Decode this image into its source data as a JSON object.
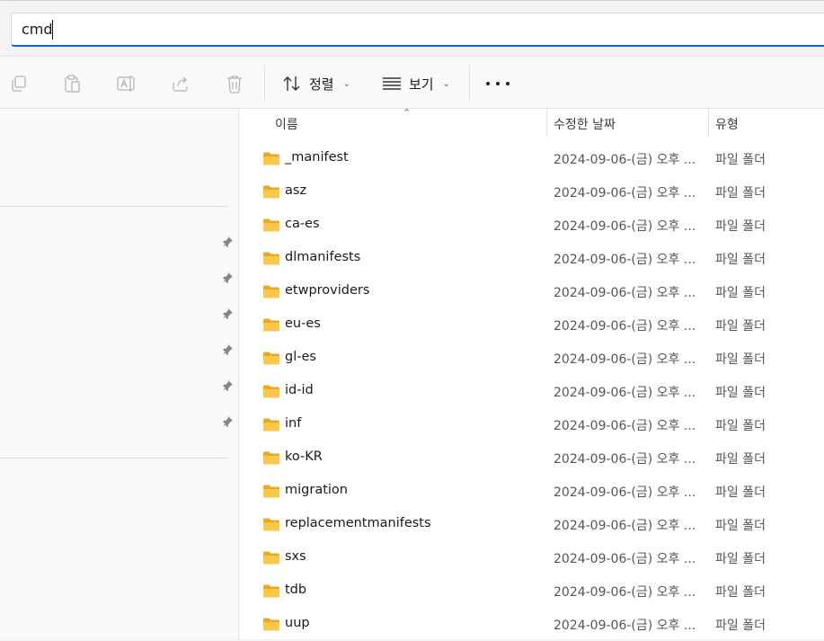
{
  "address_bar": {
    "value": "cmd"
  },
  "toolbar": {
    "icons": [
      "copy-icon",
      "paste-icon",
      "rename-icon",
      "share-icon",
      "delete-icon"
    ],
    "sort_label": "정렬",
    "view_label": "보기",
    "more_label": "..."
  },
  "columns": {
    "name": "이름",
    "date": "수정한 날짜",
    "type": "유형"
  },
  "files": [
    {
      "name": "_manifest",
      "date": "2024-09-06-(금) 오후 ...",
      "type": "파일 폴더"
    },
    {
      "name": "asz",
      "date": "2024-09-06-(금) 오후 ...",
      "type": "파일 폴더"
    },
    {
      "name": "ca-es",
      "date": "2024-09-06-(금) 오후 ...",
      "type": "파일 폴더"
    },
    {
      "name": "dlmanifests",
      "date": "2024-09-06-(금) 오후 ...",
      "type": "파일 폴더"
    },
    {
      "name": "etwproviders",
      "date": "2024-09-06-(금) 오후 ...",
      "type": "파일 폴더"
    },
    {
      "name": "eu-es",
      "date": "2024-09-06-(금) 오후 ...",
      "type": "파일 폴더"
    },
    {
      "name": "gl-es",
      "date": "2024-09-06-(금) 오후 ...",
      "type": "파일 폴더"
    },
    {
      "name": "id-id",
      "date": "2024-09-06-(금) 오후 ...",
      "type": "파일 폴더"
    },
    {
      "name": "inf",
      "date": "2024-09-06-(금) 오후 ...",
      "type": "파일 폴더"
    },
    {
      "name": "ko-KR",
      "date": "2024-09-06-(금) 오후 ...",
      "type": "파일 폴더"
    },
    {
      "name": "migration",
      "date": "2024-09-06-(금) 오후 ...",
      "type": "파일 폴더"
    },
    {
      "name": "replacementmanifests",
      "date": "2024-09-06-(금) 오후 ...",
      "type": "파일 폴더"
    },
    {
      "name": "sxs",
      "date": "2024-09-06-(금) 오후 ...",
      "type": "파일 폴더"
    },
    {
      "name": "tdb",
      "date": "2024-09-06-(금) 오후 ...",
      "type": "파일 폴더"
    },
    {
      "name": "uup",
      "date": "2024-09-06-(금) 오후 ...",
      "type": "파일 폴더"
    }
  ],
  "nav_pins": [
    "pin-icon",
    "pin-icon",
    "pin-icon",
    "pin-icon",
    "pin-icon",
    "pin-icon"
  ],
  "colors": {
    "accent": "#1164c6",
    "folder": "#f8c74b",
    "folder_dark": "#e9a920"
  }
}
